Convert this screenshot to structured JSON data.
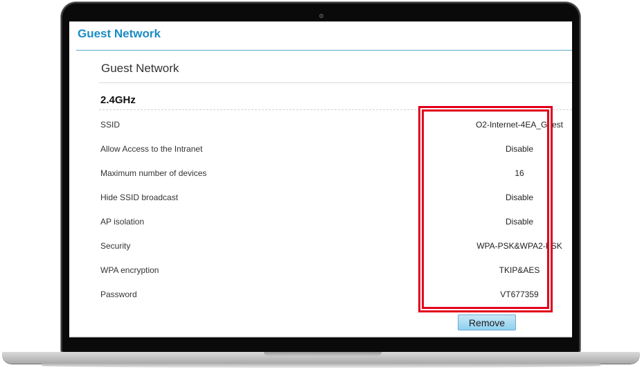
{
  "page": {
    "title": "Guest Network"
  },
  "section": {
    "title": "Guest Network",
    "band_title": "2.4GHz"
  },
  "settings": [
    {
      "label": "SSID",
      "value": "O2-Internet-4EA_Guest"
    },
    {
      "label": "Allow Access to the Intranet",
      "value": "Disable"
    },
    {
      "label": "Maximum number of devices",
      "value": "16"
    },
    {
      "label": "Hide SSID broadcast",
      "value": "Disable"
    },
    {
      "label": "AP isolation",
      "value": "Disable"
    },
    {
      "label": "Security",
      "value": "WPA-PSK&WPA2-PSK"
    },
    {
      "label": "WPA encryption",
      "value": "TKIP&AES"
    },
    {
      "label": "Password",
      "value": "VT677359"
    }
  ],
  "actions": {
    "remove_label": "Remove"
  },
  "colors": {
    "title_blue": "#1a8bc4",
    "highlight_red": "#e2001a",
    "button_blue": "#8ed0ef"
  }
}
